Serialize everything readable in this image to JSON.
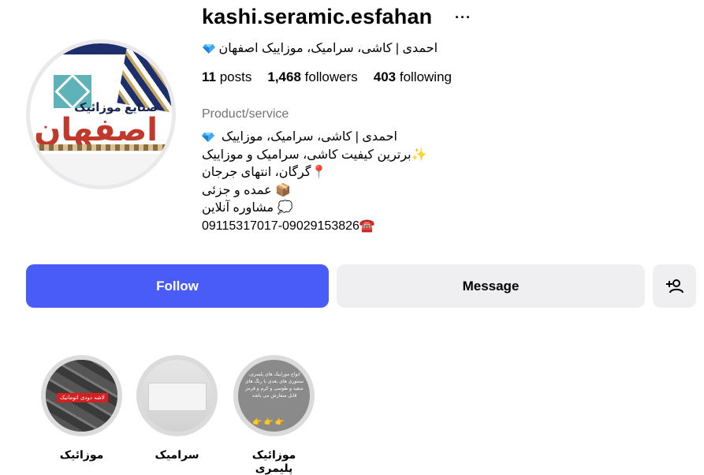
{
  "profile": {
    "username": "kashi.seramic.esfahan",
    "more_glyph": "···",
    "full_name": "احمدی | کاشی، سرامیک، موزاییک اصفهان",
    "avatar": {
      "line1": "صنایع موزائیک",
      "line2": "اصفهان"
    },
    "stats": {
      "posts_count": "11",
      "posts_label": "posts",
      "followers_count": "1,468",
      "followers_label": "followers",
      "following_count": "403",
      "following_label": "following"
    },
    "category": "Product/service",
    "bio": [
      "احمدی | کاشی، سرامیک، موزاییک",
      "برترین کیفیت کاشی، سرامیک و موزاییک",
      "گرگان، انتهای جرجان",
      "عمده و جزئی",
      "مشاوره آنلاین",
      "09115317017-09029153826"
    ],
    "bio_emojis": [
      "💎",
      "✨",
      "📍",
      "📦",
      "💭",
      "☎️"
    ]
  },
  "actions": {
    "follow_label": "Follow",
    "message_label": "Message",
    "add_user_icon": "add-user-icon"
  },
  "highlights": [
    {
      "label": "موزائیک",
      "thumb_text": "لاشه دودی اتوماتیک"
    },
    {
      "label": "سرامیک"
    },
    {
      "label": "موزائیک پلیمری",
      "thumb_text": "انواع موزاییک های پلیمری، سنتوری های بعدی با رنگ های سفید و طوسی و کرم و قرمز قابل سفارش می باشد"
    }
  ],
  "colors": {
    "follow_button": "#4a5cf8",
    "secondary_button": "#efeff1",
    "muted_text": "#737373"
  }
}
